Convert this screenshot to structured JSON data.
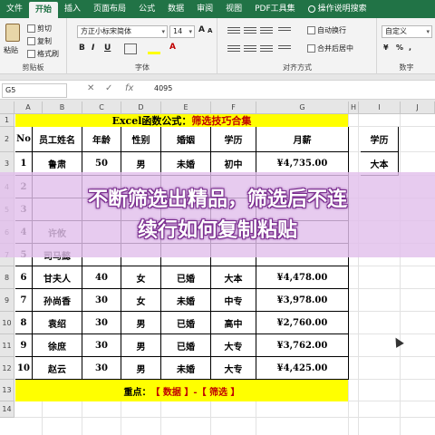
{
  "tabs": {
    "file": "文件",
    "home": "开始",
    "insert": "插入",
    "layout": "页面布局",
    "formulas": "公式",
    "data": "数据",
    "review": "审阅",
    "view": "视图",
    "pdf": "PDF工具集",
    "tell": "操作说明搜索"
  },
  "ribbon": {
    "paste": "粘贴",
    "cut": "剪切",
    "copy": "复制",
    "format_painter": "格式刷",
    "clipboard": "剪贴板",
    "font_name": "方正小标宋简体",
    "font_size": "14",
    "font": "字体",
    "wrap": "自动换行",
    "merge": "合并后居中",
    "alignment": "对齐方式",
    "number_format": "自定义",
    "number": "数字"
  },
  "formula_bar": {
    "name_box": "G5",
    "fx": "fx",
    "value": "4095"
  },
  "columns": [
    "A",
    "B",
    "C",
    "D",
    "E",
    "F",
    "G",
    "H",
    "I",
    "J"
  ],
  "rows": [
    "1",
    "2",
    "3",
    "4",
    "5",
    "6",
    "7",
    "8",
    "9",
    "10",
    "11",
    "12",
    "13",
    "14"
  ],
  "sheet": {
    "title_prefix": "Excel函数公式：",
    "title_highlight": "筛选技巧合集",
    "headers": [
      "No",
      "员工姓名",
      "年龄",
      "性别",
      "婚姻",
      "学历",
      "月薪"
    ],
    "rows": [
      [
        "1",
        "鲁肃",
        "50",
        "男",
        "未婚",
        "初中",
        "¥4,735.00"
      ],
      [
        "2",
        "",
        "",
        "",
        "",
        "",
        ""
      ],
      [
        "3",
        "",
        "",
        "",
        "",
        "",
        ""
      ],
      [
        "4",
        "许攸",
        "",
        "",
        "",
        "",
        ""
      ],
      [
        "5",
        "司马懿",
        "",
        "",
        "",
        "",
        ""
      ],
      [
        "6",
        "甘夫人",
        "40",
        "女",
        "已婚",
        "大本",
        "¥4,478.00"
      ],
      [
        "7",
        "孙尚香",
        "30",
        "女",
        "未婚",
        "中专",
        "¥3,978.00"
      ],
      [
        "8",
        "袁绍",
        "30",
        "男",
        "已婚",
        "高中",
        "¥2,760.00"
      ],
      [
        "9",
        "徐庶",
        "30",
        "男",
        "已婚",
        "大专",
        "¥3,762.00"
      ],
      [
        "10",
        "赵云",
        "30",
        "男",
        "未婚",
        "大专",
        "¥4,425.00"
      ]
    ],
    "side_header": "学历",
    "side_value": "大本",
    "note_prefix": "重点：",
    "note_highlight": "【 数据 】-【 筛选 】"
  },
  "banner": {
    "line1": "不断筛选出精品，筛选后不连",
    "line2": "续行如何复制粘贴"
  }
}
